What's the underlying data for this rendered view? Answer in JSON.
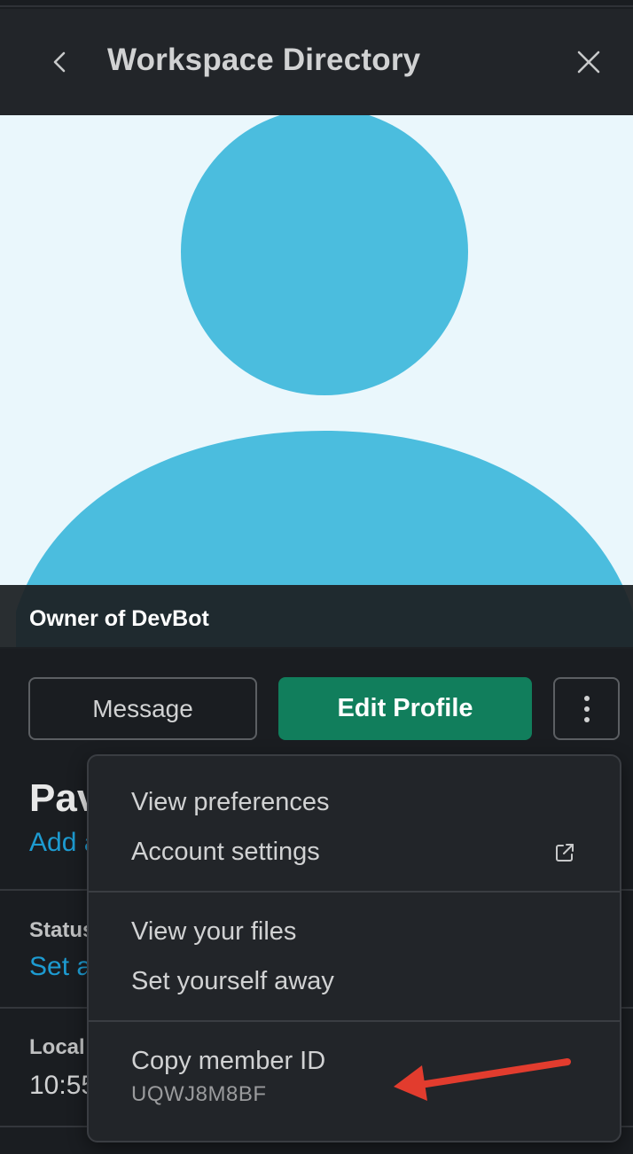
{
  "header": {
    "title": "Workspace Directory",
    "back_icon": "chevron-left-icon",
    "close_icon": "close-icon"
  },
  "profile": {
    "caption": "Owner of DevBot",
    "name_partial": "Pav",
    "add_partial": "Add a",
    "status_label": "Status",
    "status_link_partial": "Set a",
    "local_label_partial": "Local t",
    "local_value_partial": "10:55"
  },
  "actions": {
    "message_label": "Message",
    "edit_profile_label": "Edit Profile",
    "more_icon": "more-vertical-icon"
  },
  "menu": {
    "items": [
      {
        "label": "View preferences"
      },
      {
        "label": "Account settings",
        "icon": "external-link-icon"
      },
      {
        "label": "View your files"
      },
      {
        "label": "Set yourself away"
      },
      {
        "label": "Copy member ID",
        "sublabel": "UQWJ8M8BF"
      }
    ]
  },
  "colors": {
    "background": "#1a1d21",
    "header": "#222529",
    "avatar_bg": "#eaf7fc",
    "avatar_fill": "#4bbdde",
    "edit_button": "#117e5c",
    "link": "#1d9bd1",
    "annotation_arrow": "#e23c2e"
  }
}
